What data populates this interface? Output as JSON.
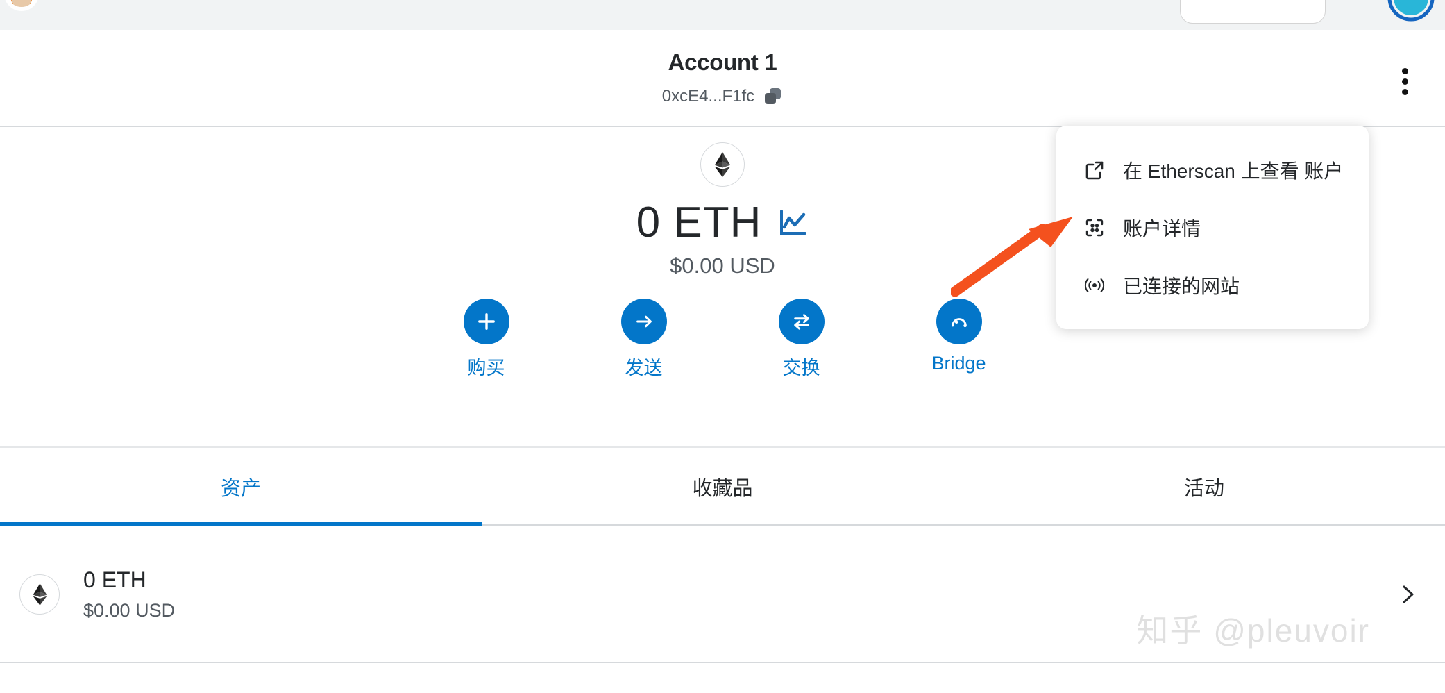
{
  "browser": {
    "firefox_logo": "firefox-logo",
    "urlbar_value": "",
    "extension_icon": "extension-icon"
  },
  "header": {
    "account_name": "Account 1",
    "account_address": "0xcE4...F1fc",
    "copy_icon": "copy-icon",
    "kebab_icon": "kebab-menu-icon"
  },
  "balance": {
    "token_logo": "ethereum-logo",
    "amount": "0 ETH",
    "chart_icon": "price-chart-icon",
    "fiat": "$0.00 USD"
  },
  "actions": [
    {
      "label": "购买",
      "icon": "plus-icon"
    },
    {
      "label": "发送",
      "icon": "arrow-right-icon"
    },
    {
      "label": "交换",
      "icon": "swap-icon"
    },
    {
      "label": "Bridge",
      "icon": "bridge-icon"
    }
  ],
  "tabs": [
    {
      "label": "资产",
      "active": true
    },
    {
      "label": "收藏品",
      "active": false
    },
    {
      "label": "活动",
      "active": false
    }
  ],
  "assets": [
    {
      "logo": "ethereum-logo",
      "amount": "0 ETH",
      "fiat": "$0.00 USD",
      "chevron": "chevron-right-icon"
    }
  ],
  "menu": {
    "items": [
      {
        "label": "在 Etherscan 上查看 账户",
        "icon": "external-link-icon"
      },
      {
        "label": "账户详情",
        "icon": "qr-scan-icon"
      },
      {
        "label": "已连接的网站",
        "icon": "connected-signal-icon"
      }
    ]
  },
  "watermark": {
    "text": "知乎 @pleuvoir"
  },
  "annotation": {
    "arrow_color": "#F4511E"
  },
  "colors": {
    "accent_blue": "#0376C9",
    "text_primary": "#24272A",
    "text_secondary": "#535A61",
    "divider": "#D6D9DC",
    "chrome_bg": "#F1F3F4"
  }
}
